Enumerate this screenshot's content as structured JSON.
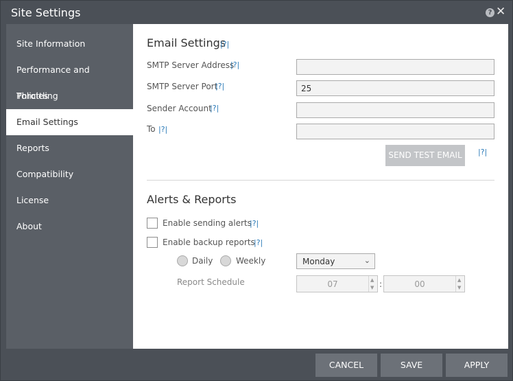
{
  "window": {
    "title": "Site Settings",
    "help_glyph": "?",
    "close_glyph": "✕"
  },
  "sidebar": {
    "items": [
      {
        "label": "Site Information"
      },
      {
        "label": "Performance and Throttling"
      },
      {
        "label": "Policies"
      },
      {
        "label": "Email Settings",
        "active": true
      },
      {
        "label": "Reports"
      },
      {
        "label": "Compatibility"
      },
      {
        "label": "License"
      },
      {
        "label": "About"
      }
    ]
  },
  "email": {
    "title": "Email Settings",
    "help": "|?|",
    "smtp_address_label": "SMTP Server Address",
    "smtp_address_value": "",
    "smtp_port_label": "SMTP Server Port",
    "smtp_port_value": "25",
    "sender_label": "Sender Account",
    "sender_value": "",
    "to_label": "To",
    "to_value": "",
    "send_test_label": "SEND TEST EMAIL"
  },
  "alerts": {
    "title": "Alerts & Reports",
    "enable_alerts_label": "Enable sending alerts",
    "enable_alerts_checked": false,
    "enable_backup_label": "Enable backup reports",
    "enable_backup_checked": false,
    "daily_label": "Daily",
    "weekly_label": "Weekly",
    "day_value": "Monday",
    "schedule_label": "Report Schedule",
    "hour_value": "07",
    "minute_value": "00",
    "separator": ":"
  },
  "footer": {
    "cancel_label": "CANCEL",
    "save_label": "SAVE",
    "apply_label": "APPLY"
  },
  "colors": {
    "frame": "#4b5057",
    "sidebar": "#5a5f66",
    "footer_button": "#6c7178",
    "link": "#2a7ab8",
    "disabled_button": "#c3c5c8"
  }
}
